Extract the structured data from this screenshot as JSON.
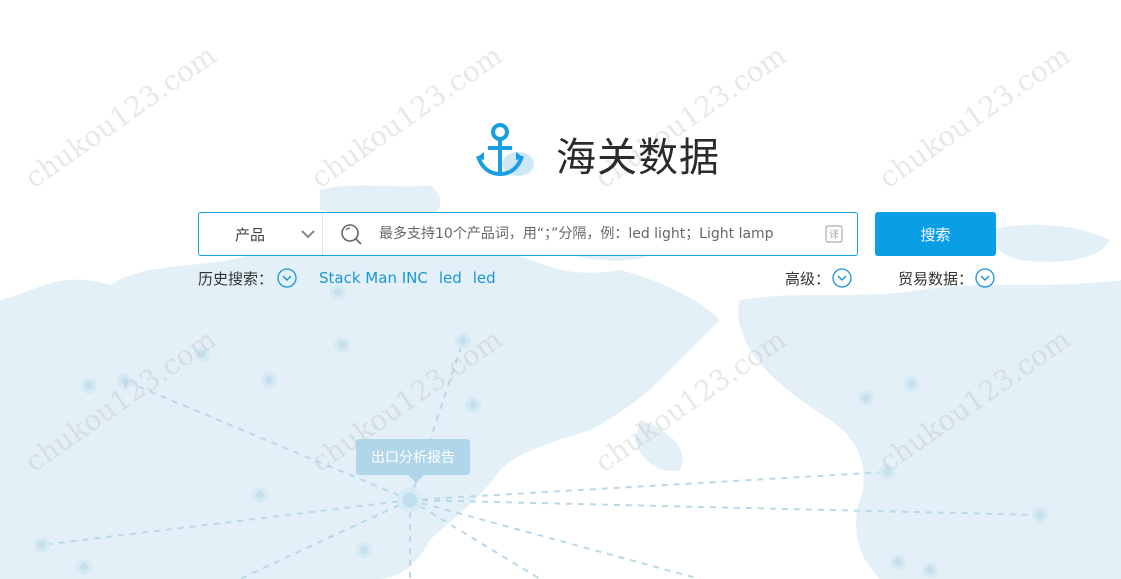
{
  "colors": {
    "accent": "#0a9ee6",
    "link": "#1a96d6",
    "map_land": "#e3f0f8",
    "map_dot": "#bcdcec"
  },
  "watermark_text": "chukou123.com",
  "logo": {
    "icon": "anchor-icon",
    "title": "海关数据"
  },
  "search": {
    "type_label": "产品",
    "placeholder": "最多支持10个产品词，用“；”分隔，例：led light；Light lamp",
    "value": "",
    "button_label": "搜索",
    "search_icon": "search-icon",
    "translate_icon": "translate-icon"
  },
  "history": {
    "label": "历史搜索：",
    "items": [
      "Stack Man INC",
      "led",
      "led"
    ]
  },
  "advanced": {
    "label": "高级："
  },
  "trade_data": {
    "label": "贸易数据："
  },
  "map_tooltip": {
    "label": "出口分析报告"
  }
}
